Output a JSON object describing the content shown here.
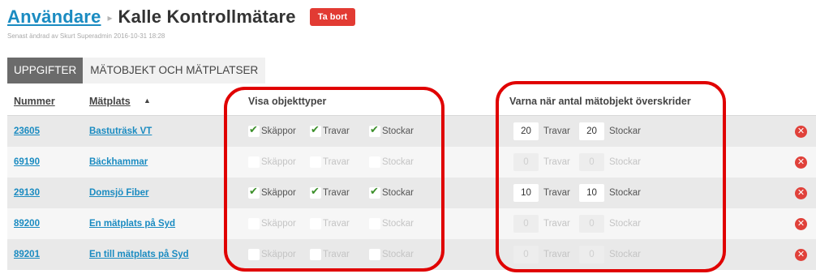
{
  "header": {
    "breadcrumb_link": "Användare",
    "breadcrumb_separator": "▸",
    "title": "Kalle Kontrollmätare",
    "delete_label": "Ta bort",
    "subline": "Senast ändrad av Skurt Superadmin 2016-10-31 18:28"
  },
  "tabs": [
    {
      "label": "UPPGIFTER",
      "active": true
    },
    {
      "label": "MÄTOBJEKT OCH MÄTPLATSER",
      "active": false
    }
  ],
  "table": {
    "headers": {
      "number": "Nummer",
      "place": "Mätplats",
      "sort_indicator": "▲",
      "types": "Visa objekttyper",
      "warn": "Varna när antal mätobjekt överskrider"
    },
    "type_labels": [
      "Skäppor",
      "Travar",
      "Stockar"
    ],
    "unit_labels": [
      "Travar",
      "Stockar"
    ],
    "rows": [
      {
        "number": "23605",
        "place": "Bastuträsk VT",
        "checked": [
          true,
          true,
          true
        ],
        "disabled": false,
        "travar": "20",
        "stockar": "20"
      },
      {
        "number": "69190",
        "place": "Bäckhammar",
        "checked": [
          false,
          false,
          false
        ],
        "disabled": true,
        "travar": "0",
        "stockar": "0"
      },
      {
        "number": "29130",
        "place": "Domsjö Fiber",
        "checked": [
          true,
          true,
          true
        ],
        "disabled": false,
        "travar": "10",
        "stockar": "10"
      },
      {
        "number": "89200",
        "place": "En mätplats på Syd",
        "checked": [
          false,
          false,
          false
        ],
        "disabled": true,
        "travar": "0",
        "stockar": "0"
      },
      {
        "number": "89201",
        "place": "En till mätplats på Syd",
        "checked": [
          false,
          false,
          false
        ],
        "disabled": true,
        "travar": "0",
        "stockar": "0"
      }
    ]
  },
  "colors": {
    "link": "#1a8bc1",
    "delete_button": "#e23b33",
    "check": "#3c8f2a",
    "annotation": "#e00000",
    "tab_active": "#6b6b6b"
  }
}
